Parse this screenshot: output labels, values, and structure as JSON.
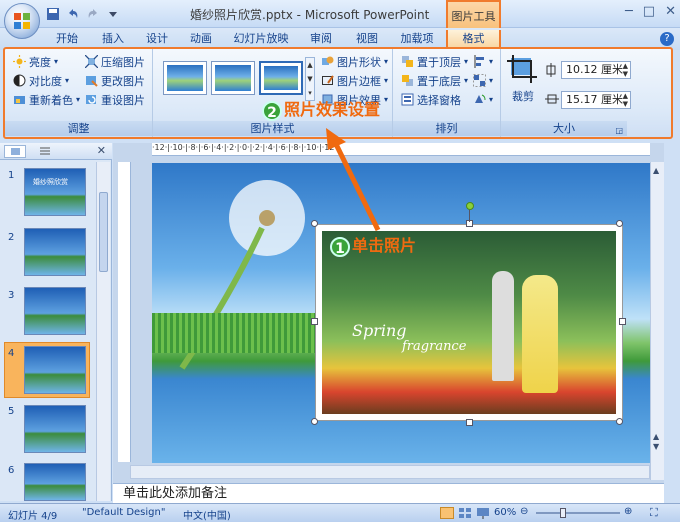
{
  "window": {
    "title": "婚纱照片欣赏.pptx - Microsoft PowerPoint",
    "minimize": "─",
    "maximize": "□",
    "close": "✕"
  },
  "context_tab": {
    "group_title": "图片工具"
  },
  "tabs": [
    {
      "label": "开始"
    },
    {
      "label": "插入"
    },
    {
      "label": "设计"
    },
    {
      "label": "动画"
    },
    {
      "label": "幻灯片放映"
    },
    {
      "label": "审阅"
    },
    {
      "label": "视图"
    },
    {
      "label": "加载项"
    },
    {
      "label": "格式"
    }
  ],
  "help": "?",
  "ribbon": {
    "adjust": {
      "label": "调整",
      "brightness": "亮度",
      "contrast": "对比度",
      "recolor": "重新着色",
      "compress": "压缩图片",
      "change": "更改图片",
      "reset": "重设图片"
    },
    "styles": {
      "label": "图片样式",
      "shape": "图片形状",
      "border": "图片边框",
      "effects": "图片效果"
    },
    "arrange": {
      "label": "排列",
      "bring_front": "置于顶层",
      "send_back": "置于底层",
      "selection_pane": "选择窗格"
    },
    "size": {
      "label": "大小",
      "crop": "裁剪",
      "height": "10.12 厘米",
      "width": "15.17 厘米"
    }
  },
  "slides_pane": {
    "close": "✕",
    "slides": [
      {
        "num": "1",
        "caption": "婚纱照欣赏"
      },
      {
        "num": "2"
      },
      {
        "num": "3"
      },
      {
        "num": "4"
      },
      {
        "num": "5"
      },
      {
        "num": "6"
      }
    ]
  },
  "ruler": "·12·|·10·|·8·|·6·|·4·|·2·|·0·|·2·|·4·|·6·|·8·|·10·|·12·",
  "photo": {
    "text_spring": "Spring",
    "text_fragrance": "fragrance"
  },
  "annotations": {
    "step1_num": "1",
    "step1_text": "单击照片",
    "step2_num": "2",
    "step2_text": "照片效果设置"
  },
  "notes_placeholder": "单击此处添加备注",
  "status": {
    "slide": "幻灯片 4/9",
    "theme": "\"Default Design\"",
    "lang": "中文(中国)",
    "zoom": "60%"
  },
  "colors": {
    "accent": "#f07b2d",
    "ribbon_text": "#15428b"
  }
}
